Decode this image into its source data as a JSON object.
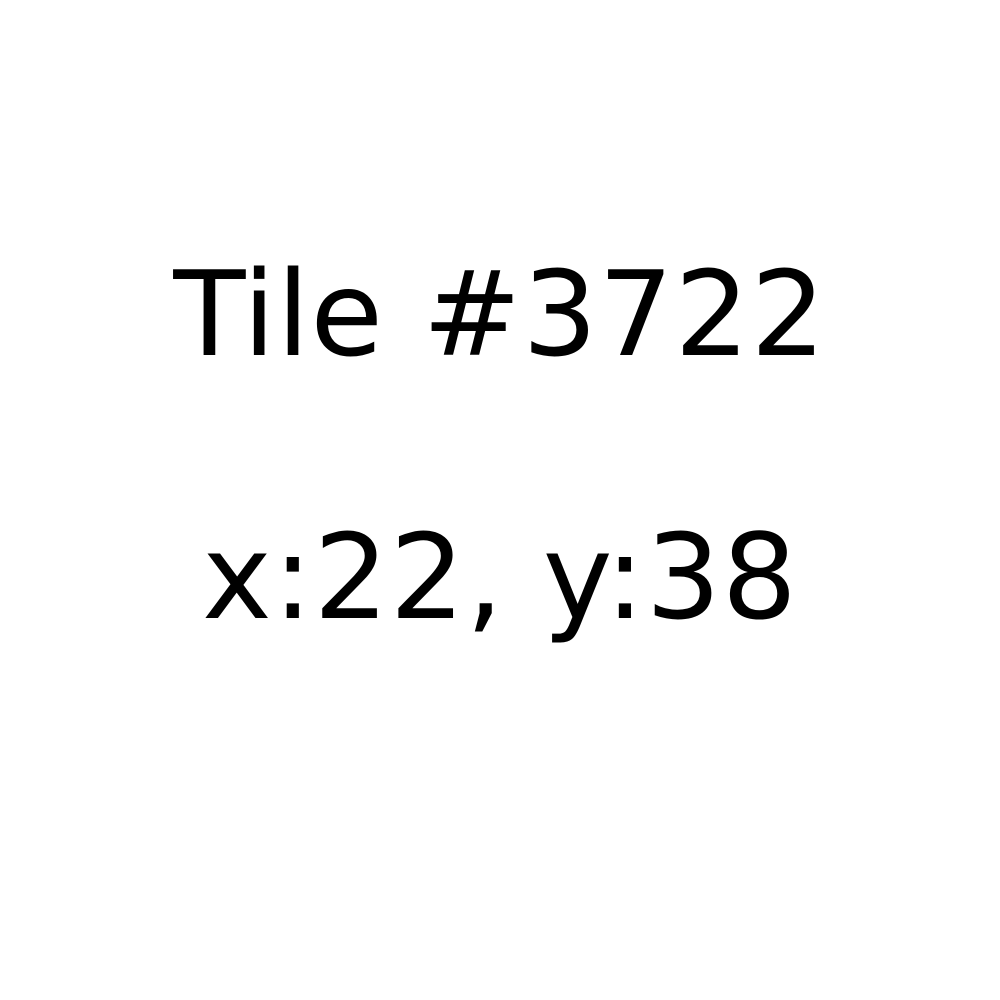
{
  "tile": {
    "title": "Tile #3722",
    "coordinates": "x:22, y:38"
  },
  "colors": {
    "background": "#ffffff",
    "text": "#000000"
  }
}
